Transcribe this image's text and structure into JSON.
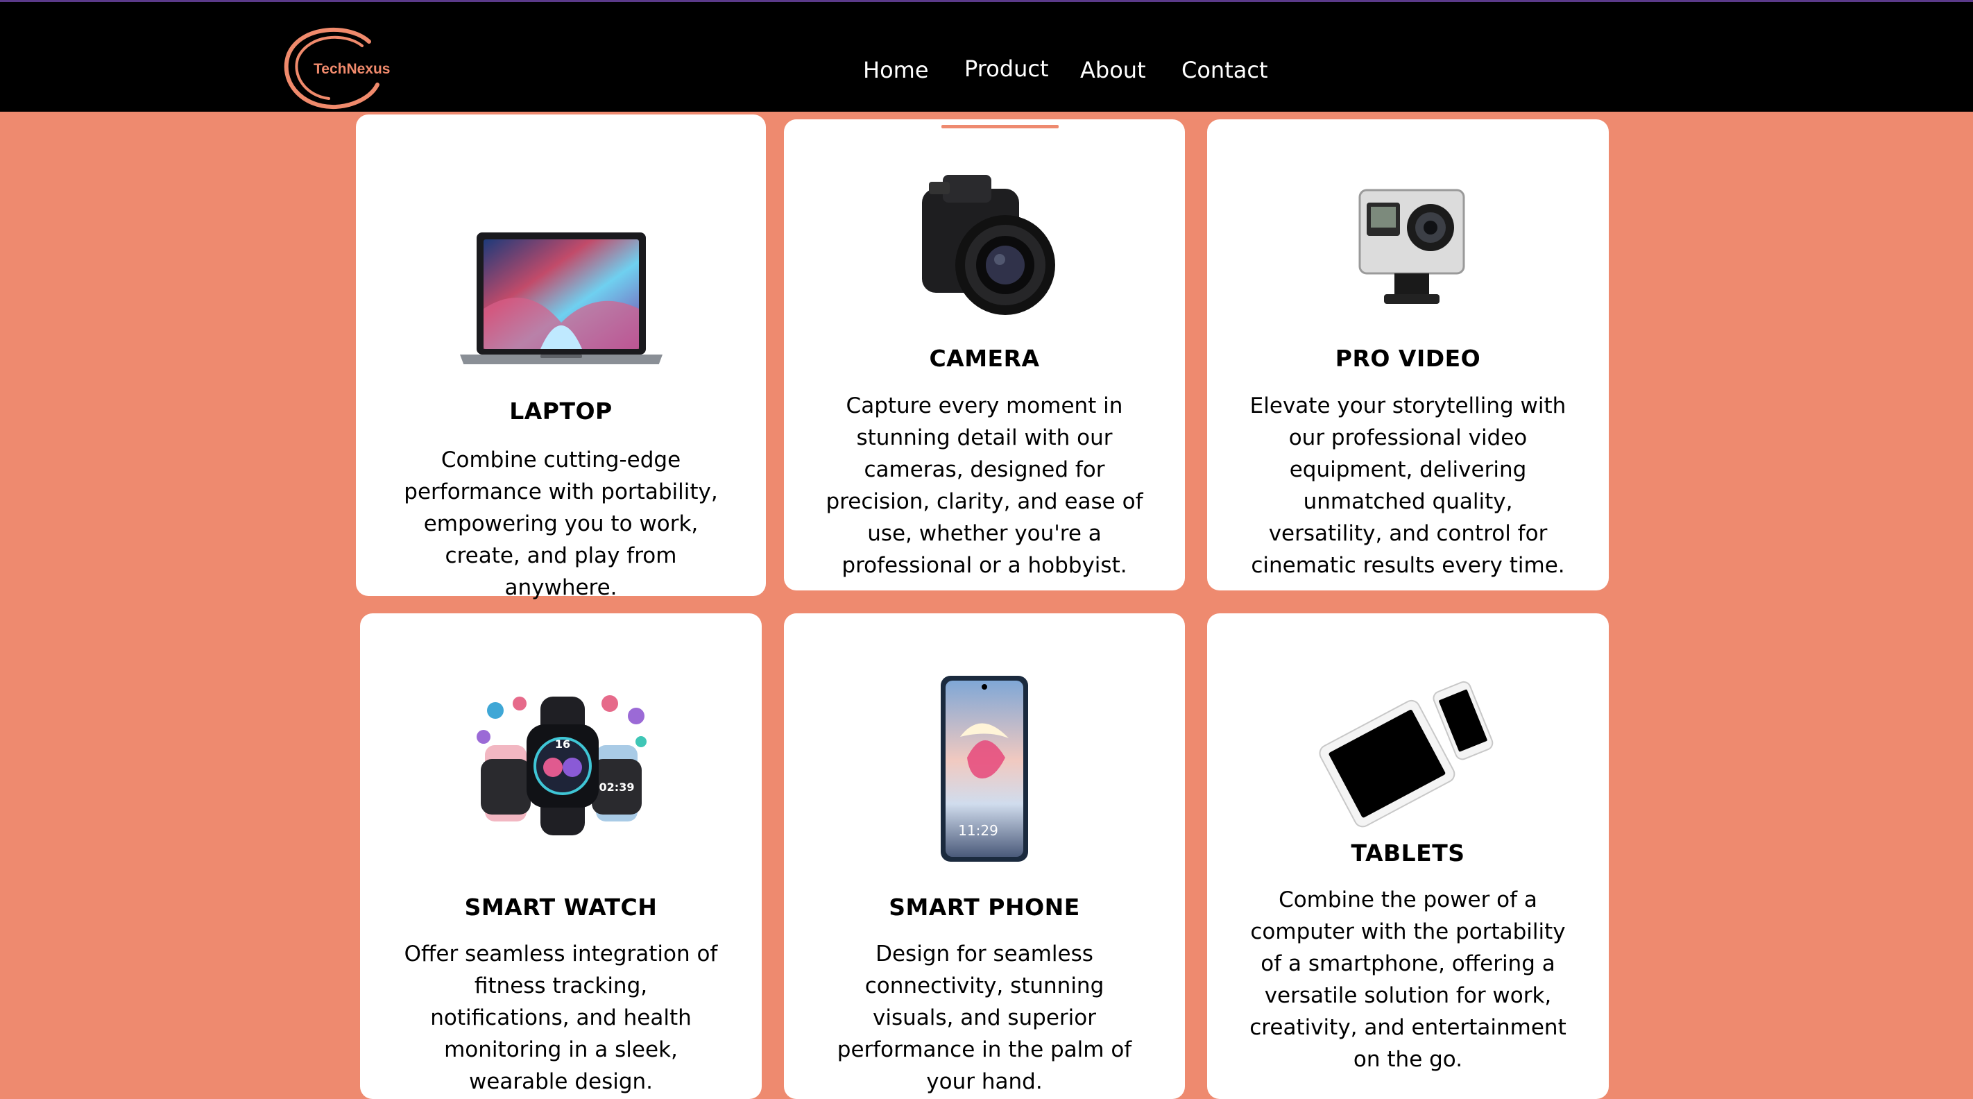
{
  "brand": {
    "name": "TechNexus",
    "accent": "#ee8a6f",
    "nav_bg": "#000000"
  },
  "nav": {
    "items": [
      {
        "label": "Home"
      },
      {
        "label": "Product"
      },
      {
        "label": "About"
      },
      {
        "label": "Contact"
      }
    ],
    "active": "Product"
  },
  "cards": [
    {
      "title": "LAPTOP",
      "description": "Combine cutting-edge performance with portability, empowering you to work, create, and play from anywhere.",
      "image": "laptop-image"
    },
    {
      "title": "CAMERA",
      "description": "Capture every moment in stunning detail with our cameras, designed for precision, clarity, and ease of use, whether you're a professional or a hobbyist.",
      "image": "camera-image"
    },
    {
      "title": "PRO VIDEO",
      "description": "Elevate your storytelling with our professional video equipment, delivering unmatched quality, versatility, and control for cinematic results every time.",
      "image": "action-camera-image"
    },
    {
      "title": "SMART WATCH",
      "description": "Offer seamless integration of fitness tracking, notifications, and health monitoring in a sleek, wearable design.",
      "image": "smartwatch-image"
    },
    {
      "title": "SMART PHONE",
      "description": "Design for seamless connectivity, stunning visuals, and superior performance in the palm of your hand.",
      "image": "smartphone-image"
    },
    {
      "title": "TABLETS",
      "description": "Combine the power of a computer with the portability of a smartphone, offering a versatile solution for work, creativity, and entertainment on the go.",
      "image": "tablet-image"
    }
  ],
  "phone_screen_time": "11:29",
  "watch_screen_time": "02:39",
  "watch_screen_digits": "16"
}
